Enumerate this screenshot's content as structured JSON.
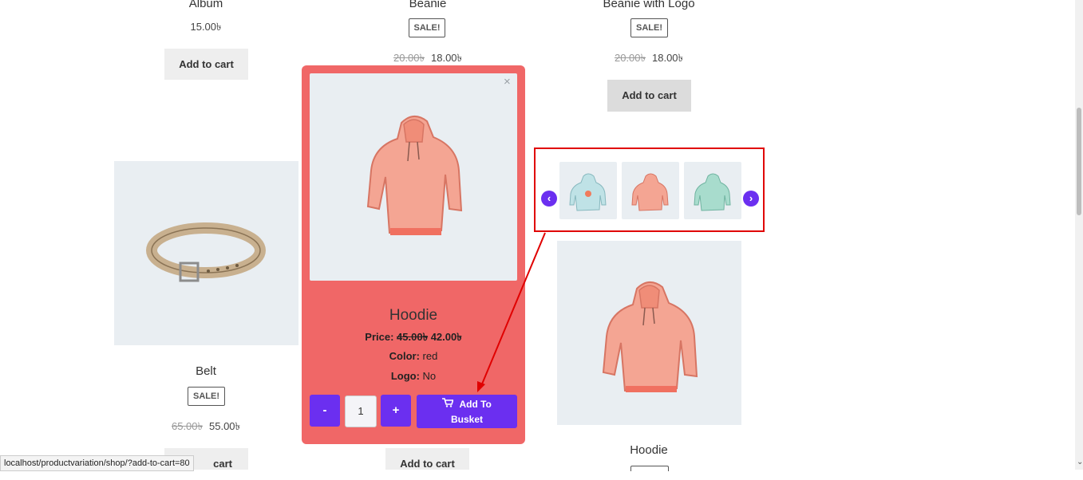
{
  "currency_symbol": "৳",
  "top_row": {
    "album": {
      "title": "Album",
      "price": "15.00৳",
      "button": "Add to cart"
    },
    "beanie": {
      "title": "Beanie",
      "badge": "SALE!",
      "old_price": "20.00৳",
      "price": "18.00৳"
    },
    "beanie_logo": {
      "title": "Beanie with Logo",
      "badge": "SALE!",
      "old_price": "20.00৳",
      "price": "18.00৳",
      "button": "Add to cart"
    }
  },
  "belt": {
    "title": "Belt",
    "badge": "SALE!",
    "old_price": "65.00৳",
    "price": "55.00৳",
    "button_partial": "cart"
  },
  "hoodie_card": {
    "title": "Hoodie"
  },
  "bottom_button": "Add to cart",
  "popup": {
    "close": "×",
    "name": "Hoodie",
    "price_label": "Price:",
    "old_price": "45.00৳",
    "price": "42.00৳",
    "color_label": "Color:",
    "color_value": "red",
    "logo_label": "Logo:",
    "logo_value": "No",
    "minus": "-",
    "plus": "+",
    "quantity": "1",
    "basket_line1": "Add To",
    "basket_line2": "Busket",
    "cart_icon": "cart-icon"
  },
  "carousel": {
    "prev_icon": "chevron-left-icon",
    "next_icon": "chevron-right-icon",
    "thumbs": [
      {
        "name": "hoodie-blue-logo",
        "color": "#a9d6dc"
      },
      {
        "name": "hoodie-red",
        "color": "#f2a08e"
      },
      {
        "name": "hoodie-green",
        "color": "#9fd5c8"
      }
    ]
  },
  "status_url": "localhost/productvariation/shop/?add-to-cart=80",
  "colors": {
    "accent": "#6b2ff0",
    "popup_bg": "#f06767",
    "annotation": "#e00000"
  }
}
